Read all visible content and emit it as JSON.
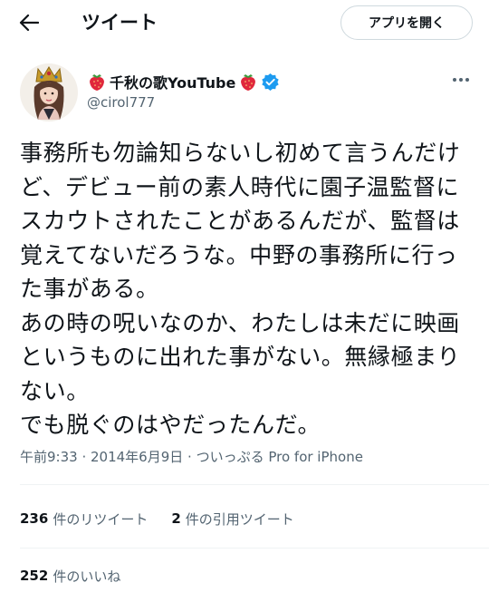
{
  "header": {
    "back_icon": "arrow-left-icon",
    "title": "ツイート",
    "open_app_label": "アプリを開く"
  },
  "tweet": {
    "display_name": "千秋の歌YouTube",
    "name_emoji": "strawberry-icon",
    "verified": true,
    "handle": "@cirol777",
    "text": "事務所も勿論知らないし初めて言うんだけど、デビュー前の素人時代に園子温監督にスカウトされたことがあるんだが、監督は覚えてないだろうな。中野の事務所に行った事がある。\nあの時の呪いなのか、わたしは未だに映画というものに出れた事がない。無縁極まりない。\nでも脱ぐのはやだったんだ。",
    "time": "午前9:33",
    "date": "2014年6月9日",
    "separator": " · ",
    "source": "ついっぷる Pro for iPhone"
  },
  "stats": {
    "retweets_count": "236",
    "retweets_label": "件のリツイート",
    "quotes_count": "2",
    "quotes_label": "件の引用ツイート",
    "likes_count": "252",
    "likes_label": "件のいいね"
  },
  "colors": {
    "text": "#0f1419",
    "secondary": "#536471",
    "verified": "#1d9bf0",
    "border": "#cfd9de",
    "divider": "#eff3f4"
  }
}
